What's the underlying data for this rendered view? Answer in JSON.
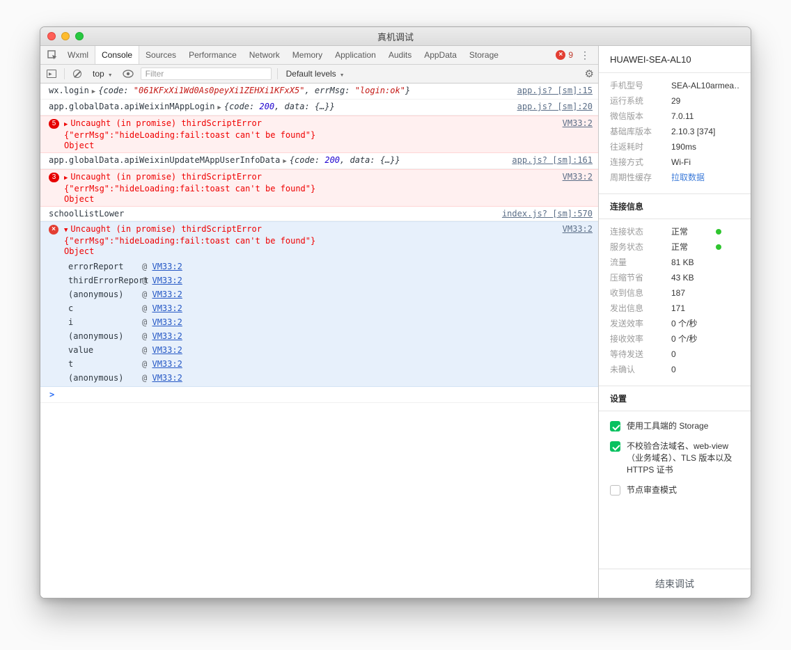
{
  "colors": {
    "error_red": "#ef0000",
    "error_bg": "#fff0f0",
    "selected_error_bg": "#e7f0fb",
    "success_green": "#2fc52f",
    "wechat_green": "#07c160",
    "link_blue": "#3c7bd9",
    "badge_red": "#e60000"
  },
  "window": {
    "title": "真机调试"
  },
  "tabs": {
    "items": [
      "Wxml",
      "Console",
      "Sources",
      "Performance",
      "Network",
      "Memory",
      "Application",
      "Audits",
      "AppData",
      "Storage"
    ],
    "active": "Console",
    "error_count": "9"
  },
  "toolbar": {
    "context": "top",
    "filter_placeholder": "Filter",
    "levels": "Default levels"
  },
  "console": {
    "m1": {
      "label": "wx.login",
      "p_open": "{code: ",
      "v_code": "\"061KFxXi1Wd0As0peyXi1ZEHXi1KFxX5\"",
      "p_mid": ", errMsg: ",
      "v_err": "\"login:ok\"",
      "p_close": "}",
      "src": "app.js? [sm]:15"
    },
    "m2": {
      "label": "app.globalData.apiWeixinMAppLogin",
      "p_open": "{code: ",
      "v_code": "200",
      "p_mid": ", data: ",
      "v_data": "{…}",
      "p_close": "}",
      "src": "app.js? [sm]:20"
    },
    "e1": {
      "count": "5",
      "line1": "Uncaught (in promise) thirdScriptError",
      "line2": "{\"errMsg\":\"hideLoading:fail:toast can't be found\"}",
      "line3": "Object",
      "src": "VM33:2"
    },
    "m3": {
      "label": "app.globalData.apiWeixinUpdateMAppUserInfoData",
      "p_open": "{code: ",
      "v_code": "200",
      "p_mid": ", data: ",
      "v_data": "{…}",
      "p_close": "}",
      "src": "app.js? [sm]:161"
    },
    "e2": {
      "count": "3",
      "line1": "Uncaught (in promise) thirdScriptError",
      "line2": "{\"errMsg\":\"hideLoading:fail:toast can't be found\"}",
      "line3": "Object",
      "src": "VM33:2"
    },
    "m4": {
      "label": "schoolListLower",
      "src": "index.js? [sm]:570"
    },
    "e3": {
      "icon": "×",
      "line1": "Uncaught (in promise) thirdScriptError",
      "line2": "{\"errMsg\":\"hideLoading:fail:toast can't be found\"}",
      "line3": "Object",
      "src": "VM33:2",
      "at_symbol": "@",
      "stack": [
        {
          "fn": "errorReport",
          "at": "@",
          "src": "VM33:2"
        },
        {
          "fn": "thirdErrorReport",
          "at": "@",
          "src": "VM33:2"
        },
        {
          "fn": "(anonymous)",
          "at": "@",
          "src": "VM33:2"
        },
        {
          "fn": "c",
          "at": "@",
          "src": "VM33:2"
        },
        {
          "fn": "i",
          "at": "@",
          "src": "VM33:2"
        },
        {
          "fn": "(anonymous)",
          "at": "@",
          "src": "VM33:2"
        },
        {
          "fn": "value",
          "at": "@",
          "src": "VM33:2"
        },
        {
          "fn": "t",
          "at": "@",
          "src": "VM33:2"
        },
        {
          "fn": "(anonymous)",
          "at": "@",
          "src": "VM33:2"
        }
      ]
    }
  },
  "sidebar": {
    "device": "HUAWEI-SEA-AL10",
    "info": [
      {
        "label": "手机型号",
        "value": "SEA-AL10armea…"
      },
      {
        "label": "运行系统",
        "value": "29"
      },
      {
        "label": "微信版本",
        "value": "7.0.11"
      },
      {
        "label": "基础库版本",
        "value": "2.10.3 [374]"
      },
      {
        "label": "往返耗时",
        "value": "190ms"
      },
      {
        "label": "连接方式",
        "value": "Wi-Fi"
      },
      {
        "label": "周期性缓存",
        "value": "拉取数据"
      }
    ],
    "conn_header": "连接信息",
    "conn": [
      {
        "label": "连接状态",
        "value": "正常"
      },
      {
        "label": "服务状态",
        "value": "正常"
      },
      {
        "label": "流量",
        "value": "81 KB"
      },
      {
        "label": "压缩节省",
        "value": "43 KB"
      },
      {
        "label": "收到信息",
        "value": "187"
      },
      {
        "label": "发出信息",
        "value": "171"
      },
      {
        "label": "发送效率",
        "value": "0 个/秒"
      },
      {
        "label": "接收效率",
        "value": "0 个/秒"
      },
      {
        "label": "等待发送",
        "value": "0"
      },
      {
        "label": "未确认",
        "value": "0"
      }
    ],
    "settings_header": "设置",
    "settings": [
      {
        "label": "使用工具端的 Storage"
      },
      {
        "label": "不校验合法域名、web-view（业务域名）、TLS 版本以及 HTTPS 证书"
      },
      {
        "label": "节点审查模式"
      }
    ],
    "end_button": "结束调试"
  }
}
